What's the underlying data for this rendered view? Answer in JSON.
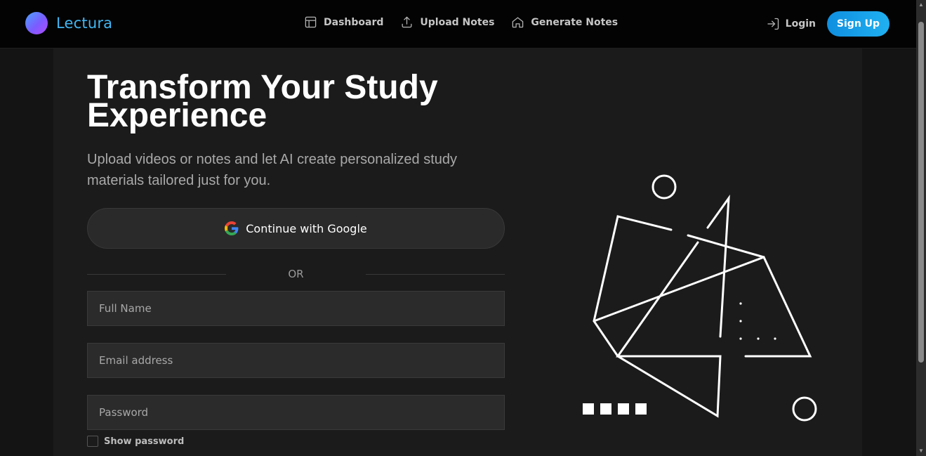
{
  "brand": {
    "name": "Lectura"
  },
  "nav": {
    "items": [
      {
        "label": "Dashboard",
        "icon": "layout-icon"
      },
      {
        "label": "Upload Notes",
        "icon": "upload-icon"
      },
      {
        "label": "Generate Notes",
        "icon": "home-icon"
      }
    ]
  },
  "auth": {
    "login_label": "Login",
    "signup_label": "Sign Up"
  },
  "hero": {
    "title": "Transform Your Study Experience",
    "subtitle": "Upload videos or notes and let AI create personalized study materials tailored just for you."
  },
  "form": {
    "google_label": "Continue with Google",
    "divider_text": "OR",
    "full_name": {
      "placeholder": "Full Name",
      "value": ""
    },
    "email": {
      "placeholder": "Email address",
      "value": ""
    },
    "password": {
      "placeholder": "Password",
      "value": ""
    },
    "show_password_label": "Show password"
  },
  "colors": {
    "accent": "#42b6f2",
    "signup_bg": "#1aa3ea",
    "background": "#141414",
    "panel": "#1b1b1b"
  }
}
